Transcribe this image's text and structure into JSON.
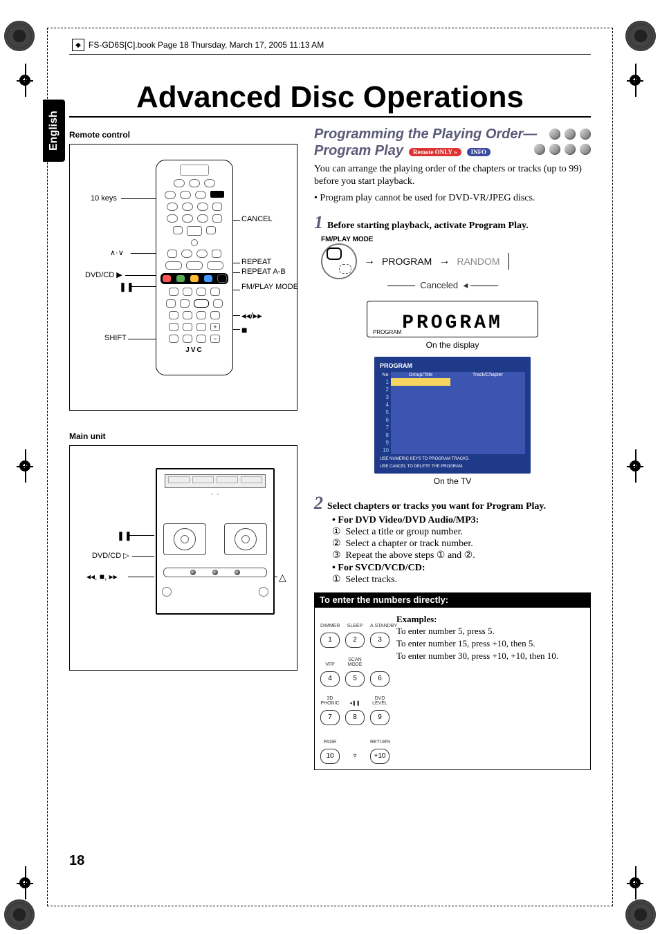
{
  "running_head": "FS-GD6S[C].book  Page 18  Thursday, March 17, 2005  11:13 AM",
  "language_tab": "English",
  "page_number": "18",
  "title": "Advanced Disc Operations",
  "left": {
    "remote_label": "Remote control",
    "mainunit_label": "Main unit",
    "remote_callouts": {
      "ten_keys": "10 keys",
      "cancel": "CANCEL",
      "up_down": "∧·∨",
      "dvd_cd_play": "DVD/CD ▶",
      "pause": "❚❚",
      "shift": "SHIFT",
      "repeat": "REPEAT",
      "repeat_ab": "REPEAT A-B",
      "fm_play_mode": "FM/PLAY MODE",
      "prev_next": "◂◂/▸▸",
      "stop": "■",
      "brand": "JVC"
    },
    "mainunit_callouts": {
      "pause": "❚❚",
      "dvd_cd_play": "DVD/CD ▷",
      "prev_stop_next": "◂◂, ■, ▸▸",
      "eject": "△"
    }
  },
  "right": {
    "section_title_1": "Programming the Playing Order—",
    "section_title_2": "Program Play",
    "badge_remote_only": "Remote ONLY",
    "badge_info": "INFO",
    "intro_p1": "You can arrange the playing order of the chapters or tracks (up to 99) before you start playback.",
    "intro_bullet": "Program play cannot be used for DVD-VR/JPEG discs.",
    "step1_num": "1",
    "step1_text": "Before starting playback, activate Program Play.",
    "fmplay_label": "FM/PLAY MODE",
    "flow_program": "PROGRAM",
    "flow_random": "RANDOM",
    "flow_canceled": "Canceled",
    "program_display_text": "PROGRAM",
    "program_display_marker": "PROGRAM",
    "on_display_caption": "On the display",
    "tv_title": "PROGRAM",
    "tv_cols": [
      "No",
      "Group/Title",
      "Track/Chapter"
    ],
    "tv_rows": [
      "1",
      "2",
      "3",
      "4",
      "5",
      "6",
      "7",
      "8",
      "9",
      "10"
    ],
    "tv_note1": "USE NUMERIC KEYS TO PROGRAM TRACKS.",
    "tv_note2": "USE CANCEL TO DELETE THE PROGRAM.",
    "on_tv_caption": "On the TV",
    "step2_num": "2",
    "step2_text": "Select chapters or tracks you want for Program Play.",
    "step2_dvd_head": "For DVD Video/DVD Audio/MP3:",
    "step2_dvd_1": "Select a title or group number.",
    "step2_dvd_2": "Select a chapter or track number.",
    "step2_dvd_3": "Repeat the above steps ① and ②.",
    "step2_svcd_head": "For SVCD/VCD/CD:",
    "step2_svcd_1": "Select tracks.",
    "enter_heading": "To enter the numbers directly:",
    "keypad": {
      "labels_row1": [
        "DIMMER",
        "SLEEP",
        "A.STANDBY"
      ],
      "labels_row2": [
        "VFP",
        "SCAN MODE",
        ""
      ],
      "labels_row3": [
        "3D PHONIC",
        "◂❚❚",
        "DVD LEVEL"
      ],
      "labels_row4": [
        "PAGE",
        "",
        "RETURN"
      ],
      "keys": [
        "1",
        "2",
        "3",
        "4",
        "5",
        "6",
        "7",
        "8",
        "9",
        "10",
        "",
        "+10"
      ]
    },
    "examples_head": "Examples:",
    "examples_l1": "To enter number 5, press 5.",
    "examples_l2": "To enter number 15, press +10, then 5.",
    "examples_l3": "To enter number 30, press +10, +10, then 10."
  }
}
